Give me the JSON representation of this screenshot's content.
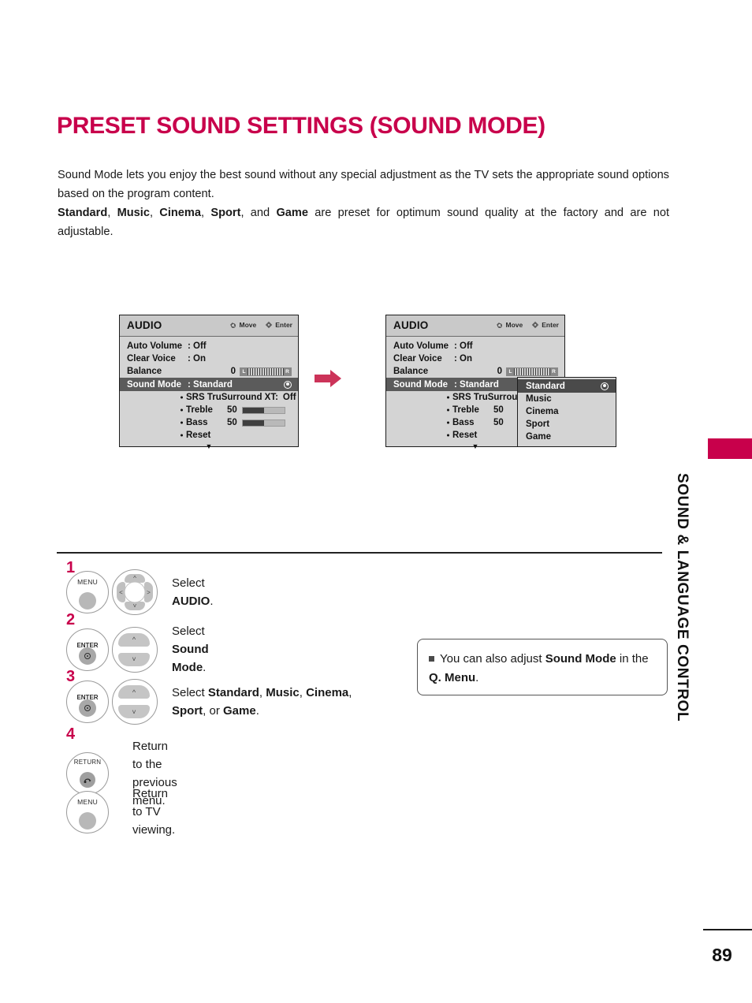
{
  "page": {
    "title": "PRESET SOUND SETTINGS (SOUND MODE)",
    "number": "89",
    "side_label": "SOUND & LANGUAGE CONTROL",
    "accent_color": "#c8004b"
  },
  "intro": {
    "line1": "Sound Mode lets you enjoy the best sound without any special adjustment as the TV sets the appropriate",
    "line2": "sound options based on the program content.",
    "p2_bold_1": "Standard",
    "p2_sep_1": ", ",
    "p2_bold_2": "Music",
    "p2_sep_2": ", ",
    "p2_bold_3": "Cinema",
    "p2_sep_3": ", ",
    "p2_bold_4": "Sport",
    "p2_sep_4": ", and ",
    "p2_bold_5": "Game",
    "p2_tail": " are preset for optimum sound quality at the factory and are",
    "p2_line2": "not adjustable."
  },
  "osd": {
    "title": "AUDIO",
    "hint_move": "Move",
    "hint_enter": "Enter",
    "rows": [
      {
        "label": "Auto Volume",
        "value": ": Off"
      },
      {
        "label": "Clear Voice",
        "value": ": On"
      }
    ],
    "balance": {
      "label": "Balance",
      "value": "0",
      "left_cap": "L",
      "right_cap": "R"
    },
    "sound_mode": {
      "label": "Sound Mode",
      "value": ": Standard"
    },
    "subrows": {
      "srs_label": "SRS TruSurround XT:",
      "srs_value": "Off",
      "srs_label_clipped": "SRS TruSurround XT",
      "treble_label": "Treble",
      "treble_value": "50",
      "treble_percent": 50,
      "bass_label": "Bass",
      "bass_value": "50",
      "bass_percent": 50,
      "reset_label": "Reset",
      "more_arrow": "▼"
    }
  },
  "dropdown": {
    "items": [
      {
        "label": "Standard",
        "selected": true
      },
      {
        "label": "Music",
        "selected": false
      },
      {
        "label": "Cinema",
        "selected": false
      },
      {
        "label": "Sport",
        "selected": false
      },
      {
        "label": "Game",
        "selected": false
      }
    ]
  },
  "steps": [
    {
      "number": "1",
      "button": "MENU",
      "wheel": "four-way",
      "text_pre": "Select ",
      "text_bold": "AUDIO",
      "text_post": "."
    },
    {
      "number": "2",
      "button": "ENTER",
      "wheel": "up-down",
      "text_pre": "Select ",
      "text_bold": "Sound Mode",
      "text_post": "."
    },
    {
      "number": "3",
      "button": "ENTER",
      "wheel": "up-down",
      "text_pre": "Select ",
      "text_bold_1": "Standard",
      "text_sep_1": ", ",
      "text_bold_2": "Music",
      "text_sep_2": ",",
      "text_bold_3": "Cinema",
      "text_sep_3": ", ",
      "text_bold_4": "Sport",
      "text_sep_4": ", or ",
      "text_bold_5": "Game",
      "text_post": "."
    },
    {
      "number": "4",
      "button": "RETURN",
      "text": "Return to the previous menu."
    },
    {
      "number": "",
      "button": "MENU",
      "text": "Return to TV viewing."
    }
  ],
  "note": {
    "pre": "You can also adjust ",
    "bold_1": "Sound Mode",
    "mid": " in the ",
    "bold_2": "Q. Menu",
    "post": "."
  },
  "icons": {
    "move": "dpad-icon",
    "enter": "enter-diamond-icon",
    "flow": "right-arrow-icon",
    "more": "chevron-down-icon",
    "radio": "radio-selected-icon",
    "return": "return-arrow-icon"
  }
}
